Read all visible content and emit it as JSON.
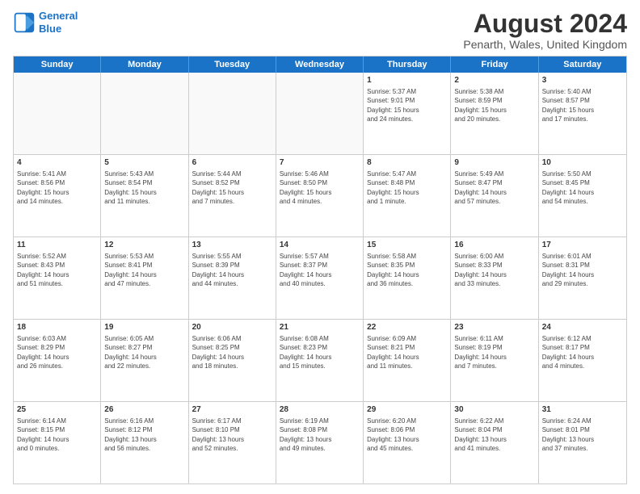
{
  "header": {
    "logo_line1": "General",
    "logo_line2": "Blue",
    "month_title": "August 2024",
    "location": "Penarth, Wales, United Kingdom"
  },
  "days_of_week": [
    "Sunday",
    "Monday",
    "Tuesday",
    "Wednesday",
    "Thursday",
    "Friday",
    "Saturday"
  ],
  "weeks": [
    [
      {
        "day": "",
        "text": ""
      },
      {
        "day": "",
        "text": ""
      },
      {
        "day": "",
        "text": ""
      },
      {
        "day": "",
        "text": ""
      },
      {
        "day": "1",
        "text": "Sunrise: 5:37 AM\nSunset: 9:01 PM\nDaylight: 15 hours\nand 24 minutes."
      },
      {
        "day": "2",
        "text": "Sunrise: 5:38 AM\nSunset: 8:59 PM\nDaylight: 15 hours\nand 20 minutes."
      },
      {
        "day": "3",
        "text": "Sunrise: 5:40 AM\nSunset: 8:57 PM\nDaylight: 15 hours\nand 17 minutes."
      }
    ],
    [
      {
        "day": "4",
        "text": "Sunrise: 5:41 AM\nSunset: 8:56 PM\nDaylight: 15 hours\nand 14 minutes."
      },
      {
        "day": "5",
        "text": "Sunrise: 5:43 AM\nSunset: 8:54 PM\nDaylight: 15 hours\nand 11 minutes."
      },
      {
        "day": "6",
        "text": "Sunrise: 5:44 AM\nSunset: 8:52 PM\nDaylight: 15 hours\nand 7 minutes."
      },
      {
        "day": "7",
        "text": "Sunrise: 5:46 AM\nSunset: 8:50 PM\nDaylight: 15 hours\nand 4 minutes."
      },
      {
        "day": "8",
        "text": "Sunrise: 5:47 AM\nSunset: 8:48 PM\nDaylight: 15 hours\nand 1 minute."
      },
      {
        "day": "9",
        "text": "Sunrise: 5:49 AM\nSunset: 8:47 PM\nDaylight: 14 hours\nand 57 minutes."
      },
      {
        "day": "10",
        "text": "Sunrise: 5:50 AM\nSunset: 8:45 PM\nDaylight: 14 hours\nand 54 minutes."
      }
    ],
    [
      {
        "day": "11",
        "text": "Sunrise: 5:52 AM\nSunset: 8:43 PM\nDaylight: 14 hours\nand 51 minutes."
      },
      {
        "day": "12",
        "text": "Sunrise: 5:53 AM\nSunset: 8:41 PM\nDaylight: 14 hours\nand 47 minutes."
      },
      {
        "day": "13",
        "text": "Sunrise: 5:55 AM\nSunset: 8:39 PM\nDaylight: 14 hours\nand 44 minutes."
      },
      {
        "day": "14",
        "text": "Sunrise: 5:57 AM\nSunset: 8:37 PM\nDaylight: 14 hours\nand 40 minutes."
      },
      {
        "day": "15",
        "text": "Sunrise: 5:58 AM\nSunset: 8:35 PM\nDaylight: 14 hours\nand 36 minutes."
      },
      {
        "day": "16",
        "text": "Sunrise: 6:00 AM\nSunset: 8:33 PM\nDaylight: 14 hours\nand 33 minutes."
      },
      {
        "day": "17",
        "text": "Sunrise: 6:01 AM\nSunset: 8:31 PM\nDaylight: 14 hours\nand 29 minutes."
      }
    ],
    [
      {
        "day": "18",
        "text": "Sunrise: 6:03 AM\nSunset: 8:29 PM\nDaylight: 14 hours\nand 26 minutes."
      },
      {
        "day": "19",
        "text": "Sunrise: 6:05 AM\nSunset: 8:27 PM\nDaylight: 14 hours\nand 22 minutes."
      },
      {
        "day": "20",
        "text": "Sunrise: 6:06 AM\nSunset: 8:25 PM\nDaylight: 14 hours\nand 18 minutes."
      },
      {
        "day": "21",
        "text": "Sunrise: 6:08 AM\nSunset: 8:23 PM\nDaylight: 14 hours\nand 15 minutes."
      },
      {
        "day": "22",
        "text": "Sunrise: 6:09 AM\nSunset: 8:21 PM\nDaylight: 14 hours\nand 11 minutes."
      },
      {
        "day": "23",
        "text": "Sunrise: 6:11 AM\nSunset: 8:19 PM\nDaylight: 14 hours\nand 7 minutes."
      },
      {
        "day": "24",
        "text": "Sunrise: 6:12 AM\nSunset: 8:17 PM\nDaylight: 14 hours\nand 4 minutes."
      }
    ],
    [
      {
        "day": "25",
        "text": "Sunrise: 6:14 AM\nSunset: 8:15 PM\nDaylight: 14 hours\nand 0 minutes."
      },
      {
        "day": "26",
        "text": "Sunrise: 6:16 AM\nSunset: 8:12 PM\nDaylight: 13 hours\nand 56 minutes."
      },
      {
        "day": "27",
        "text": "Sunrise: 6:17 AM\nSunset: 8:10 PM\nDaylight: 13 hours\nand 52 minutes."
      },
      {
        "day": "28",
        "text": "Sunrise: 6:19 AM\nSunset: 8:08 PM\nDaylight: 13 hours\nand 49 minutes."
      },
      {
        "day": "29",
        "text": "Sunrise: 6:20 AM\nSunset: 8:06 PM\nDaylight: 13 hours\nand 45 minutes."
      },
      {
        "day": "30",
        "text": "Sunrise: 6:22 AM\nSunset: 8:04 PM\nDaylight: 13 hours\nand 41 minutes."
      },
      {
        "day": "31",
        "text": "Sunrise: 6:24 AM\nSunset: 8:01 PM\nDaylight: 13 hours\nand 37 minutes."
      }
    ]
  ]
}
